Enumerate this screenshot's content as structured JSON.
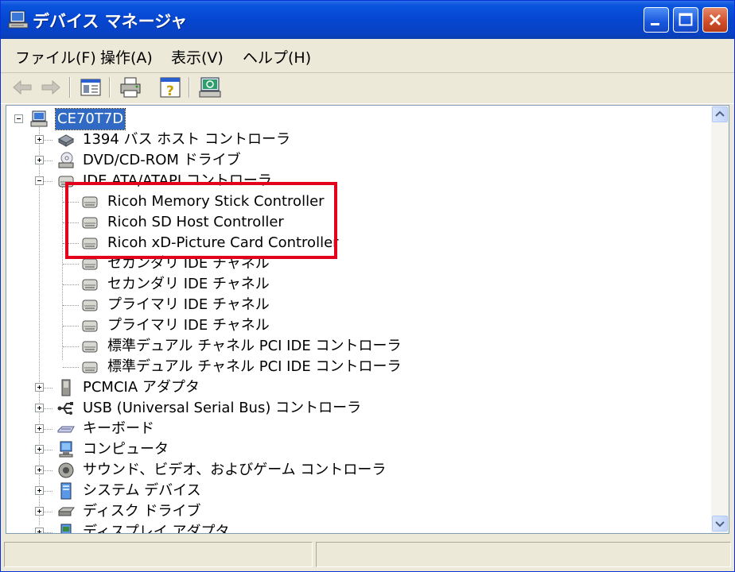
{
  "window": {
    "title": "デバイス マネージャ",
    "title_icon": "computer-icon"
  },
  "menu": [
    "ファイル(F)",
    "操作(A)",
    "表示(V)",
    "ヘルプ(H)"
  ],
  "toolbar": [
    "back-arrow-icon",
    "forward-arrow-icon",
    "properties-icon",
    "print-icon",
    "help-icon",
    "scan-hardware-icon"
  ],
  "tree": {
    "root": "CE70T7D",
    "categories": [
      {
        "label": "1394 バス ホスト コントローラ",
        "icon": "firewire-icon"
      },
      {
        "label": "DVD/CD-ROM ドライブ",
        "icon": "cd-drive-icon"
      },
      {
        "label": "IDE ATA/ATAPI コントローラ",
        "icon": "ide-controller-icon"
      },
      {
        "label": "PCMCIA アダプタ",
        "icon": "pcmcia-icon"
      },
      {
        "label": "USB (Universal Serial Bus) コントローラ",
        "icon": "usb-icon"
      },
      {
        "label": "キーボード",
        "icon": "keyboard-icon"
      },
      {
        "label": "コンピュータ",
        "icon": "computer-icon"
      },
      {
        "label": "サウンド、ビデオ、およびゲーム コントローラ",
        "icon": "sound-icon"
      },
      {
        "label": "システム デバイス",
        "icon": "system-device-icon"
      },
      {
        "label": "ディスク ドライブ",
        "icon": "disk-drive-icon"
      },
      {
        "label": "ディスプレイ アダプタ",
        "icon": "display-adapter-icon"
      }
    ],
    "ide_children": [
      "Ricoh Memory Stick Controller",
      "Ricoh SD Host Controller",
      "Ricoh xD-Picture Card Controller",
      "セカンダリ IDE チャネル",
      "セカンダリ IDE チャネル",
      "プライマリ IDE チャネル",
      "プライマリ IDE チャネル",
      "標準デュアル チャネル PCI IDE コントローラ",
      "標準デュアル チャネル PCI IDE コントローラ"
    ]
  },
  "colors": {
    "titlebar": "#0a54de",
    "selection": "#316ac5",
    "highlight_box": "#e3001b"
  }
}
